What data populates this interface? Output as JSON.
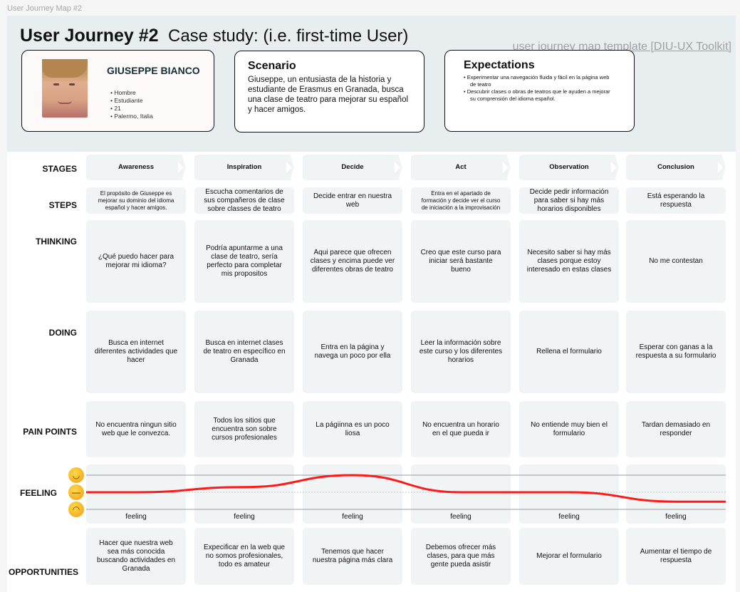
{
  "frame_label": "User Journey Map #2",
  "header": {
    "title": "User Journey #2",
    "subtitle": "Case study: (i.e. first-time User)",
    "template_link": "user journey map template [DIU-UX Toolkit]"
  },
  "persona": {
    "name": "GIUSEPPE BIANCO",
    "attributes": [
      "Hombre",
      "Estudiante",
      "21",
      "Palermo, Italia"
    ]
  },
  "scenario": {
    "title": "Scenario",
    "text": "Giuseppe, un entusiasta de la historia y estudiante de Erasmus en Granada, busca una clase de teatro para mejorar su español y hacer amigos."
  },
  "expectations": {
    "title": "Expectations",
    "items": [
      "Experimentar una navegación fluida y fácil en la página web de teatro",
      "Descubrir clases o obras de teatros que le ayuden a mejorar su comprensión del idioma español."
    ]
  },
  "row_labels": {
    "stages": "STAGES",
    "steps": "STEPS",
    "thinking": "THINKING",
    "doing": "DOING",
    "pain_points": "PAIN POINTS",
    "feeling": "FEELING",
    "opportunities": "OPPORTUNITIES"
  },
  "stages": [
    "Awareness",
    "Inspiration",
    "Decide",
    "Act",
    "Observation",
    "Conclusion"
  ],
  "steps": [
    "El propósito de Giuseppe es mejorar su dominio del idioma español y hacer amigos.",
    "Escucha comentarios de sus compañeros de clase sobre classes de teatro",
    "Decide entrar en nuestra web",
    "Entra en el apartado de formación  y decide ver el curso de iniciación a la improvisación",
    "Decide pedir información para saber si hay más horarios disponibles",
    "Está esperando la respuesta"
  ],
  "thinking": [
    "¿Qué puedo hacer para mejorar mi idioma?",
    "Podría apuntarme a una clase de teatro, sería perfecto para completar mis propositos",
    "Aqui parece que ofrecen clases y encima puede ver diferentes obras de teatro",
    "Creo que este curso para iniciar será bastante bueno",
    "Necesito saber si hay más clases porque estoy interesado en estas clases",
    "No me contestan"
  ],
  "doing": [
    "Busca en internet diferentes actividades que hacer",
    "Busca en internet clases de teatro en específico en Granada",
    "Entra en la página y navega un poco por ella",
    "Leer la información sobre este curso y los diferentes horarios",
    "Rellena el formulario",
    "Esperar con ganas a la respuesta a su formulario"
  ],
  "pain_points": [
    "No encuentra ningun sitio web que le convezca.",
    "Todos los sitios que encuentra son sobre cursos profesionales",
    "La págiinna es un poco liosa",
    "No encuentra un horario en el que pueda ir",
    "No entiende muy bien el formulario",
    "Tardan demasiado en responder"
  ],
  "feeling": {
    "labels": [
      "feeling",
      "feeling",
      "feeling",
      "feeling",
      "feeling",
      "feeling"
    ],
    "values": [
      0,
      0.3,
      1,
      0,
      0,
      -0.55
    ],
    "scale": [
      "happy",
      "neutral",
      "sad"
    ],
    "line_color": "#ff1a1a"
  },
  "opportunities": [
    "Hacer que nuestra web sea más conocida buscando actividades en Granada",
    "Expecificar en la web que no somos profesionales, todo es amateur",
    "Tenemos que hacer nuestra página más clara",
    "Debemos ofrecer más clases, para que más gente pueda asistir",
    "Mejorar el formulario",
    "Aumentar el tiempo de respuesta"
  ]
}
